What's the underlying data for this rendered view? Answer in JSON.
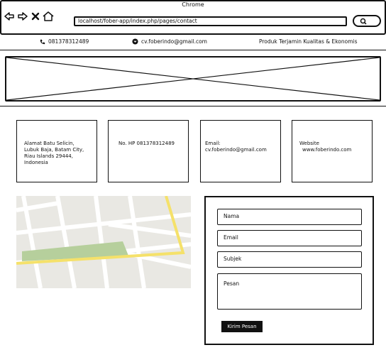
{
  "window": {
    "title": "Chrome",
    "url": "localhost/fober-app/index.php/pages/contact"
  },
  "icons": [
    "back-icon",
    "forward-icon",
    "close-icon",
    "home-icon",
    "search-icon",
    "phone-icon",
    "email-icon"
  ],
  "topbar": {
    "phone": "081378312489",
    "email": "cv.foberindo@gmail.com",
    "tagline": "Produk Terjamin Kualitas & Ekonomis"
  },
  "cards": {
    "address": [
      "Alamat Batu Selicin,",
      "Lubuk Baja, Batam City,",
      "Riau Islands 29444,",
      "Indonesia"
    ],
    "phone": "No. HP 081378312489",
    "email": [
      "Email:",
      "cv.foberindo@gmail.com"
    ],
    "website": [
      "Website",
      "www.foberindo.com"
    ]
  },
  "form": {
    "nama": "Nama",
    "email": "Email",
    "subjek": "Subjek",
    "pesan": "Pesan",
    "submit": "Kirim Pesan"
  },
  "colors": {
    "road_major": "#f5e16a",
    "park": "#b6cf9c",
    "map_bg": "#e9e8e3",
    "ink": "#111111"
  }
}
